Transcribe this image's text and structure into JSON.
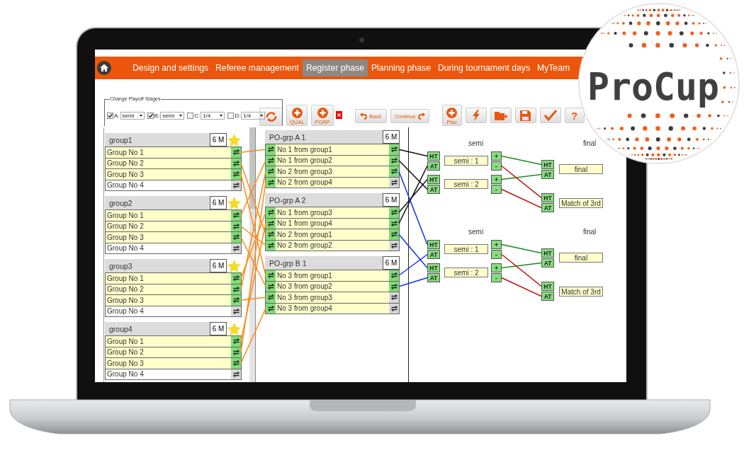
{
  "nav": {
    "items": [
      {
        "label": "Design and settings",
        "selected": false
      },
      {
        "label": "Referee management",
        "selected": false
      },
      {
        "label": "Register phase",
        "selected": true
      },
      {
        "label": "Planning phase",
        "selected": false
      },
      {
        "label": "During tournament days",
        "selected": false
      },
      {
        "label": "MyTeam",
        "selected": false
      }
    ]
  },
  "stage_box": {
    "legend": "Change Playoff Stages",
    "stages": [
      {
        "label": "A:",
        "checked": true,
        "value": "semi"
      },
      {
        "label": "B:",
        "checked": true,
        "value": "semi"
      },
      {
        "label": "C:",
        "checked": false,
        "value": "1/4"
      },
      {
        "label": "D:",
        "checked": false,
        "value": "1/4"
      }
    ]
  },
  "toolbar": [
    {
      "kind": "refresh"
    },
    {
      "kind": "add",
      "label": "QUAL"
    },
    {
      "kind": "add-remove",
      "label": "PGRP"
    },
    {
      "kind": "back",
      "label": "Back"
    },
    {
      "kind": "continue",
      "label": "Continue"
    },
    {
      "kind": "add",
      "label": "Plac"
    },
    {
      "kind": "bolt"
    },
    {
      "kind": "folder"
    },
    {
      "kind": "save"
    },
    {
      "kind": "check"
    },
    {
      "kind": "text",
      "label": "?"
    }
  ],
  "groups": [
    {
      "name": "group1",
      "matches": "6 M",
      "rows": [
        {
          "label": "Group No 1",
          "qualified": true
        },
        {
          "label": "Group No 2",
          "qualified": true
        },
        {
          "label": "Group No 3",
          "qualified": true
        },
        {
          "label": "Group No 4",
          "qualified": false
        }
      ]
    },
    {
      "name": "group2",
      "matches": "6 M",
      "rows": [
        {
          "label": "Group No 1",
          "qualified": true
        },
        {
          "label": "Group No 2",
          "qualified": true
        },
        {
          "label": "Group No 3",
          "qualified": true
        },
        {
          "label": "Group No 4",
          "qualified": false
        }
      ]
    },
    {
      "name": "group3",
      "matches": "6 M",
      "rows": [
        {
          "label": "Group No 1",
          "qualified": true
        },
        {
          "label": "Group No 2",
          "qualified": true
        },
        {
          "label": "Group No 3",
          "qualified": true
        },
        {
          "label": "Group No 4",
          "qualified": false
        }
      ]
    },
    {
      "name": "group4",
      "matches": "6 M",
      "rows": [
        {
          "label": "Group No 1",
          "qualified": true
        },
        {
          "label": "Group No 2",
          "qualified": true
        },
        {
          "label": "Group No 3",
          "qualified": true
        },
        {
          "label": "Group No 4",
          "qualified": false
        }
      ]
    }
  ],
  "playoff_groups": [
    {
      "name": "PO-grp A 1",
      "matches": "6 M",
      "rows": [
        {
          "label": "No 1 from group1",
          "assigned": true
        },
        {
          "label": "No 1 from group2",
          "assigned": true
        },
        {
          "label": "No 2 from group3",
          "assigned": true
        },
        {
          "label": "No 2 from group4",
          "assigned": false
        }
      ]
    },
    {
      "name": "PO-grp A 2",
      "matches": "6 M",
      "rows": [
        {
          "label": "No 1 from group3",
          "assigned": true
        },
        {
          "label": "No 1 from group4",
          "assigned": true
        },
        {
          "label": "No 2 from group1",
          "assigned": true
        },
        {
          "label": "No 2 from group2",
          "assigned": false
        }
      ]
    },
    {
      "name": "PO-grp B 1",
      "matches": "6 M",
      "rows": [
        {
          "label": "No 3 from group1",
          "assigned": true
        },
        {
          "label": "No 3 from group2",
          "assigned": true
        },
        {
          "label": "No 3 from group3",
          "assigned": false
        },
        {
          "label": "No 3 from group4",
          "assigned": false
        }
      ]
    }
  ],
  "brackets": [
    {
      "semi_title": "semi",
      "final_title": "final",
      "semis": [
        {
          "label": "semi : 1",
          "home": "HT",
          "away": "AT",
          "winner": "+",
          "loser": "-"
        },
        {
          "label": "semi : 2",
          "home": "HT",
          "away": "AT",
          "winner": "+",
          "loser": "-"
        }
      ],
      "finals": [
        {
          "label": "final",
          "home": "HT",
          "away": "AT"
        },
        {
          "label": "Match of 3rd",
          "home": "HT",
          "away": "AT"
        }
      ]
    },
    {
      "semi_title": "semi",
      "final_title": "final",
      "semis": [
        {
          "label": "semi : 1",
          "home": "HT",
          "away": "AT",
          "winner": "+",
          "loser": "-"
        },
        {
          "label": "semi : 2",
          "home": "HT",
          "away": "AT",
          "winner": "+",
          "loser": "-"
        }
      ],
      "finals": [
        {
          "label": "final",
          "home": "HT",
          "away": "AT"
        },
        {
          "label": "Match of 3rd",
          "home": "HT",
          "away": "AT"
        }
      ]
    }
  ],
  "logo": {
    "text": "ProCup"
  }
}
